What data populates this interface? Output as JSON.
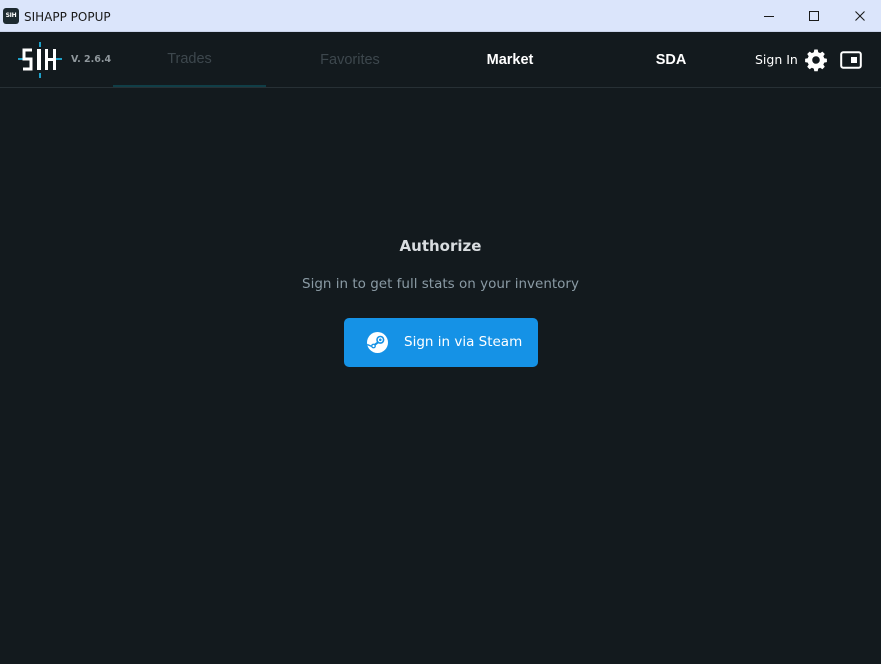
{
  "window": {
    "title": "SIHAPP POPUP",
    "app_icon_text": "SIH",
    "controls": [
      "minimize-icon",
      "maximize-icon",
      "close-icon"
    ]
  },
  "header": {
    "logo_text": "SIH",
    "version": "V. 2.6.4",
    "tabs": [
      {
        "label": "Trades",
        "state": "active-dimmed"
      },
      {
        "label": "Favorites",
        "state": "dimmed"
      },
      {
        "label": "Market",
        "state": "normal"
      },
      {
        "label": "SDA",
        "state": "normal"
      }
    ],
    "sign_in_label": "Sign In",
    "settings_icon": "gear-icon",
    "popout_icon": "picture-in-picture-icon"
  },
  "auth": {
    "title": "Authorize",
    "subtitle": "Sign in to get full stats on your inventory",
    "button_label": "Sign in via Steam",
    "button_icon": "steam-icon"
  },
  "colors": {
    "background": "#131a1e",
    "titlebar": "#dbe5fb",
    "accent": "#1592e6",
    "logo_accent": "#1fa0c8",
    "active_tab_underline": "#103e47",
    "dim_text": "#3d474d",
    "subtitle_text": "#8a9aa4"
  }
}
